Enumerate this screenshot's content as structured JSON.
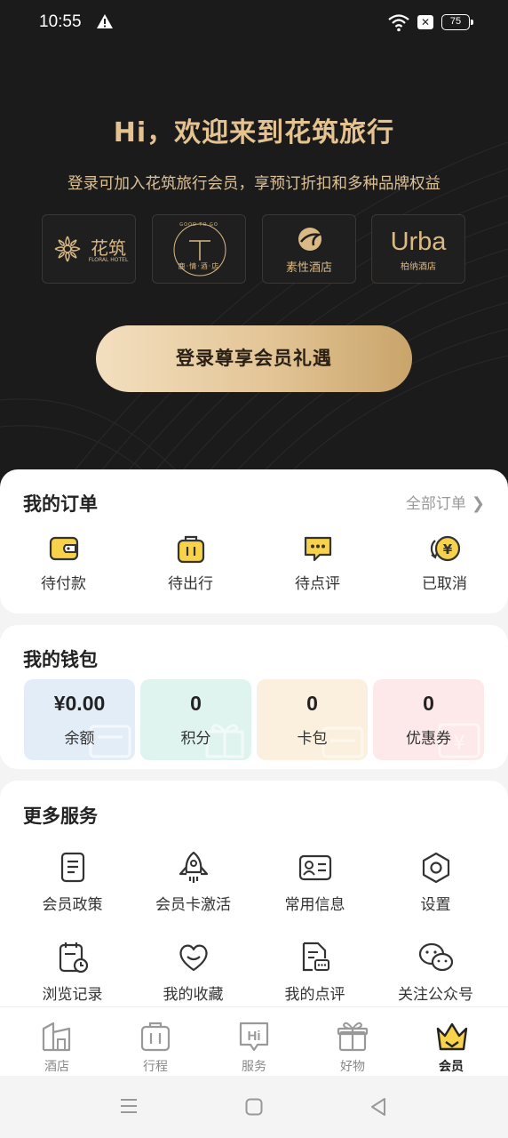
{
  "status_bar": {
    "time": "10:55",
    "battery": "75"
  },
  "hero": {
    "title": "Hi，欢迎来到花筑旅行",
    "subtitle": "登录可加入花筑旅行会员，享预订折扣和多种品牌权益",
    "brands": [
      {
        "name": "花筑",
        "sub": "FLORAL HOTEL"
      },
      {
        "name": "鹿·情·酒·店",
        "sub": "GOOD TO GO"
      },
      {
        "name": "素性酒店",
        "sub": ""
      },
      {
        "name": "Urba",
        "sub": "柏纳酒店"
      }
    ],
    "login_button": "登录尊享会员礼遇"
  },
  "orders": {
    "title": "我的订单",
    "all_link": "全部订单",
    "items": [
      {
        "label": "待付款",
        "icon": "wallet-icon"
      },
      {
        "label": "待出行",
        "icon": "luggage-icon"
      },
      {
        "label": "待点评",
        "icon": "comment-icon"
      },
      {
        "label": "已取消",
        "icon": "yen-refund-icon"
      }
    ]
  },
  "wallet": {
    "title": "我的钱包",
    "tiles": [
      {
        "value": "¥0.00",
        "label": "余额",
        "color": "#e3edf8"
      },
      {
        "value": "0",
        "label": "积分",
        "color": "#dff3ef"
      },
      {
        "value": "0",
        "label": "卡包",
        "color": "#fbf0dd"
      },
      {
        "value": "0",
        "label": "优惠券",
        "color": "#fde9e9"
      }
    ]
  },
  "services": {
    "title": "更多服务",
    "items": [
      {
        "label": "会员政策",
        "icon": "document-icon"
      },
      {
        "label": "会员卡激活",
        "icon": "rocket-icon"
      },
      {
        "label": "常用信息",
        "icon": "id-card-icon"
      },
      {
        "label": "设置",
        "icon": "settings-icon"
      },
      {
        "label": "浏览记录",
        "icon": "history-icon"
      },
      {
        "label": "我的收藏",
        "icon": "heart-icon"
      },
      {
        "label": "我的点评",
        "icon": "review-icon"
      },
      {
        "label": "关注公众号",
        "icon": "wechat-icon"
      }
    ]
  },
  "tabbar": {
    "items": [
      {
        "label": "酒店",
        "icon": "hotel-icon"
      },
      {
        "label": "行程",
        "icon": "trip-icon"
      },
      {
        "label": "服务",
        "icon": "service-icon"
      },
      {
        "label": "好物",
        "icon": "gift-icon"
      },
      {
        "label": "会员",
        "icon": "crown-icon"
      }
    ],
    "active": "会员"
  },
  "colors": {
    "gold": "#e5c391",
    "accent_yellow": "#f7d24a",
    "dark_bg": "#1c1b1c"
  }
}
